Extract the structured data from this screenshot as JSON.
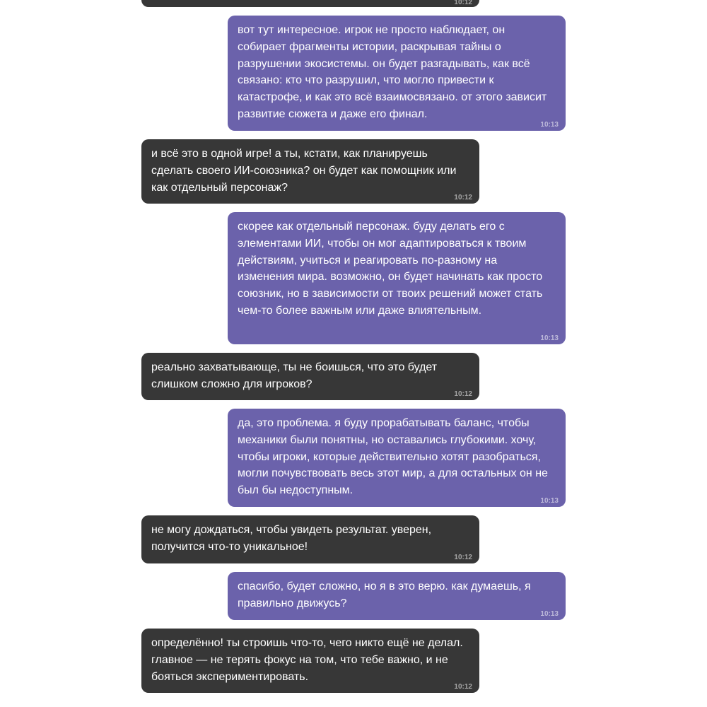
{
  "messages": [
    {
      "side": "in",
      "text": "",
      "time": "10:12"
    },
    {
      "side": "out",
      "text": "вот тут интересное. игрок не просто наблюдает, он собирает фрагменты истории, раскрывая тайны о разрушении экосистемы. он будет разгадывать, как всё связано: кто что разрушил, что могло привести к катастрофе, и как это всё взаимосвязано. от этого зависит развитие сюжета и даже его финал.",
      "time": "10:13"
    },
    {
      "side": "in",
      "text": "и всё это в одной игре! а ты, кстати, как планируешь сделать своего ИИ-союзника? он будет как помощник или как отдельный персонаж?",
      "time": "10:12"
    },
    {
      "side": "out",
      "text": "скорее как отдельный персонаж. буду делать его с элементами ИИ, чтобы он мог адаптироваться к твоим действиям, учиться и реагировать по-разному на изменения мира. возможно, он будет начинать как просто союзник, но в зависимости от твоих решений может стать чем-то более важным или даже влиятельным.",
      "time": "10:13"
    },
    {
      "side": "in",
      "text": "реально захватывающе, ты не боишься, что это будет слишком сложно для игроков?",
      "time": "10:12"
    },
    {
      "side": "out",
      "text": "да, это проблема. я буду прорабатывать баланс, чтобы механики были понятны, но оставались глубокими. хочу, чтобы игроки, которые действительно хотят разобраться, могли почувствовать весь этот мир, а для остальных он не был бы недоступным.",
      "time": "10:13"
    },
    {
      "side": "in",
      "text": "не могу дождаться, чтобы увидеть результат. уверен, получится что-то уникальное!",
      "time": "10:12"
    },
    {
      "side": "out",
      "text": "спасибо, будет сложно, но я в это верю. как думаешь, я правильно движусь?",
      "time": "10:13"
    },
    {
      "side": "in",
      "text": "определённо! ты строишь что-то, чего никто ещё не делал. главное — не терять фокус на том, что тебе важно, и не бояться экспериментировать.",
      "time": "10:12"
    }
  ]
}
